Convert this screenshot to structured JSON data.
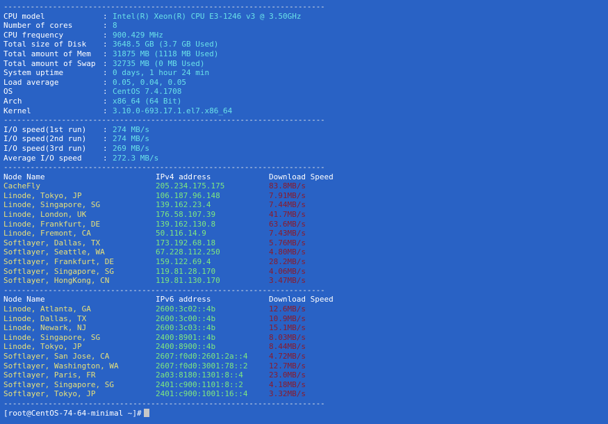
{
  "separator": "------------------------------------------------------------------------",
  "sysinfo": [
    {
      "key": "CPU model",
      "value": "Intel(R) Xeon(R) CPU E3-1246 v3 @ 3.50GHz"
    },
    {
      "key": "Number of cores",
      "value": "8"
    },
    {
      "key": "CPU frequency",
      "value": "900.429 MHz"
    },
    {
      "key": "Total size of Disk",
      "value": "3648.5 GB (3.7 GB Used)"
    },
    {
      "key": "Total amount of Mem",
      "value": "31875 MB (1118 MB Used)"
    },
    {
      "key": "Total amount of Swap",
      "value": "32735 MB (0 MB Used)"
    },
    {
      "key": "System uptime",
      "value": "0 days, 1 hour 24 min"
    },
    {
      "key": "Load average",
      "value": "0.05, 0.04, 0.05"
    },
    {
      "key": "OS",
      "value": "CentOS 7.4.1708"
    },
    {
      "key": "Arch",
      "value": "x86_64 (64 Bit)"
    },
    {
      "key": "Kernel",
      "value": "3.10.0-693.17.1.el7.x86_64"
    }
  ],
  "io": [
    {
      "key": "I/O speed(1st run)",
      "value": "274 MB/s"
    },
    {
      "key": "I/O speed(2nd run)",
      "value": "274 MB/s"
    },
    {
      "key": "I/O speed(3rd run)",
      "value": "269 MB/s"
    },
    {
      "key": "Average I/O speed",
      "value": "272.3 MB/s"
    }
  ],
  "colon": ":",
  "ipv4_table": {
    "headers": {
      "node": "Node Name",
      "ip": "IPv4 address",
      "speed": "Download Speed"
    },
    "rows": [
      {
        "node": "CacheFly",
        "ip": "205.234.175.175",
        "speed": "83.8MB/s"
      },
      {
        "node": "Linode, Tokyo, JP",
        "ip": "106.187.96.148",
        "speed": "7.91MB/s"
      },
      {
        "node": "Linode, Singapore, SG",
        "ip": "139.162.23.4",
        "speed": "7.44MB/s"
      },
      {
        "node": "Linode, London, UK",
        "ip": "176.58.107.39",
        "speed": "41.7MB/s"
      },
      {
        "node": "Linode, Frankfurt, DE",
        "ip": "139.162.130.8",
        "speed": "63.6MB/s"
      },
      {
        "node": "Linode, Fremont, CA",
        "ip": "50.116.14.9",
        "speed": "7.43MB/s"
      },
      {
        "node": "Softlayer, Dallas, TX",
        "ip": "173.192.68.18",
        "speed": "5.76MB/s"
      },
      {
        "node": "Softlayer, Seattle, WA",
        "ip": "67.228.112.250",
        "speed": "4.80MB/s"
      },
      {
        "node": "Softlayer, Frankfurt, DE",
        "ip": "159.122.69.4",
        "speed": "28.2MB/s"
      },
      {
        "node": "Softlayer, Singapore, SG",
        "ip": "119.81.28.170",
        "speed": "4.06MB/s"
      },
      {
        "node": "Softlayer, HongKong, CN",
        "ip": "119.81.130.170",
        "speed": "3.47MB/s"
      }
    ]
  },
  "ipv6_table": {
    "headers": {
      "node": "Node Name",
      "ip": "IPv6 address",
      "speed": "Download Speed"
    },
    "rows": [
      {
        "node": "Linode, Atlanta, GA",
        "ip": "2600:3c02::4b",
        "speed": "12.6MB/s"
      },
      {
        "node": "Linode, Dallas, TX",
        "ip": "2600:3c00::4b",
        "speed": "10.9MB/s"
      },
      {
        "node": "Linode, Newark, NJ",
        "ip": "2600:3c03::4b",
        "speed": "15.1MB/s"
      },
      {
        "node": "Linode, Singapore, SG",
        "ip": "2400:8901::4b",
        "speed": "8.03MB/s"
      },
      {
        "node": "Linode, Tokyo, JP",
        "ip": "2400:8900::4b",
        "speed": "8.44MB/s"
      },
      {
        "node": "Softlayer, San Jose, CA",
        "ip": "2607:f0d0:2601:2a::4",
        "speed": "4.72MB/s"
      },
      {
        "node": "Softlayer, Washington, WA",
        "ip": "2607:f0d0:3001:78::2",
        "speed": "12.7MB/s"
      },
      {
        "node": "Softlayer, Paris, FR",
        "ip": "2a03:8180:1301:8::4",
        "speed": "23.0MB/s"
      },
      {
        "node": "Softlayer, Singapore, SG",
        "ip": "2401:c900:1101:8::2",
        "speed": "4.18MB/s"
      },
      {
        "node": "Softlayer, Tokyo, JP",
        "ip": "2401:c900:1001:16::4",
        "speed": "3.32MB/s"
      }
    ]
  },
  "prompt": "[root@CentOS-74-64-minimal ~]#",
  "colors": {
    "background": "#2962c5",
    "key_text": "#ffffff",
    "value_text": "#69e0e8",
    "node_text": "#e6e07a",
    "ip_text": "#7fe87f",
    "speed_text": "#8b1a2a"
  }
}
